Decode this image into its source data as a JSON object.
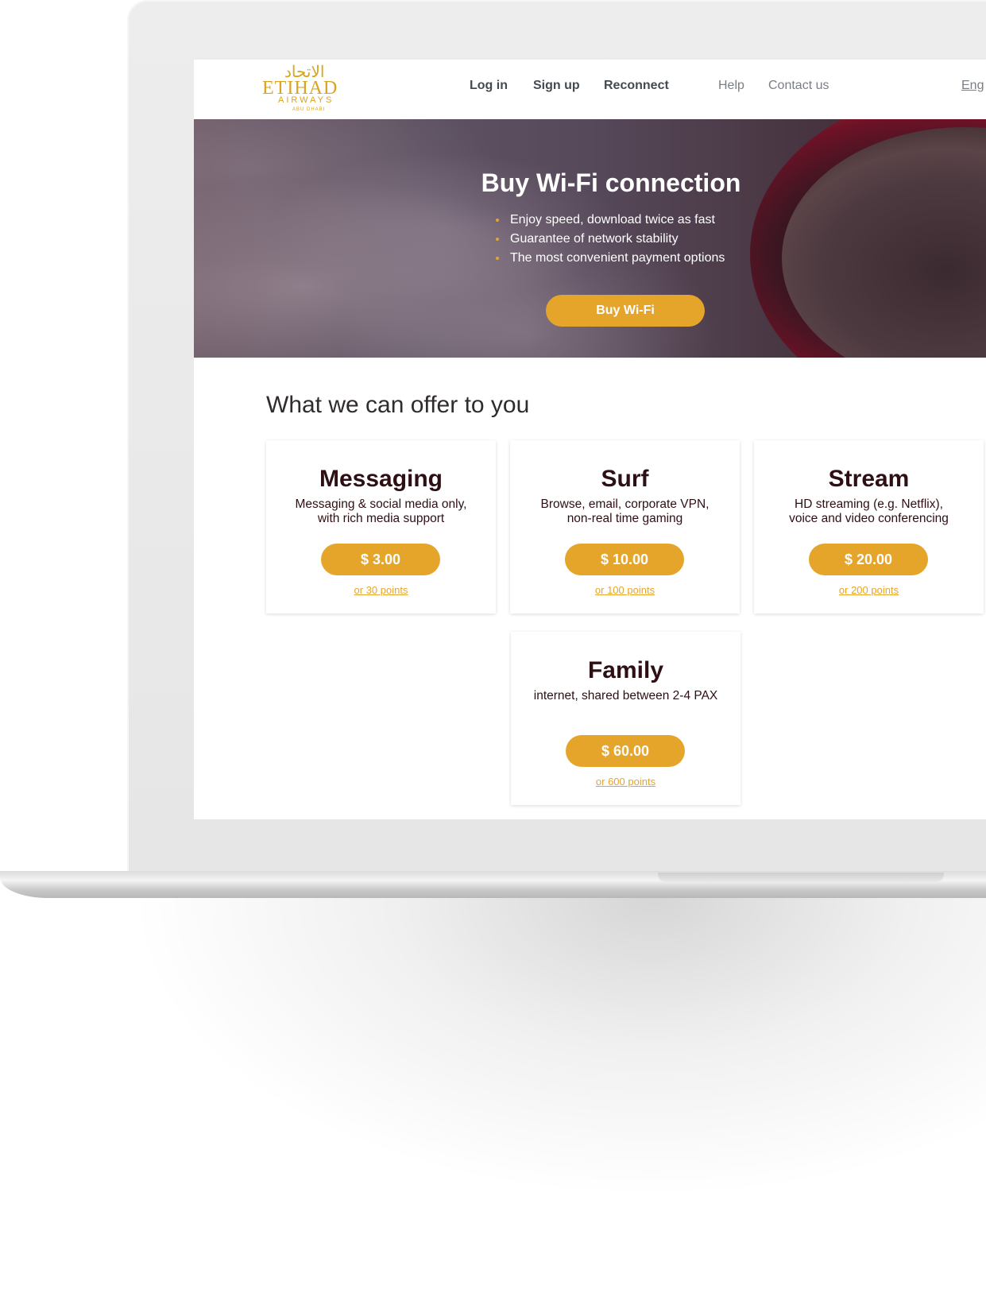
{
  "logo": {
    "arabic": "الاتحاد",
    "name": "ETIHAD",
    "sub": "AIRWAYS",
    "sub2": "ABU DHABI"
  },
  "nav": {
    "login": "Log in",
    "signup": "Sign up",
    "reconnect": "Reconnect",
    "help": "Help",
    "contact": "Contact us",
    "lang": "Eng"
  },
  "hero": {
    "title": "Buy Wi-Fi connection",
    "bullets": [
      "Enjoy speed, download twice as fast",
      "Guarantee of network stability",
      "The most convenient payment options"
    ],
    "button": "Buy Wi-Fi"
  },
  "offers": {
    "title": "What we can offer to you",
    "plans": [
      {
        "name": "Messaging",
        "desc_line1": "Messaging & social media only,",
        "desc_line2": "with rich media support",
        "price": "$ 3.00",
        "points": "or 30 points"
      },
      {
        "name": "Surf",
        "desc_line1": "Browse, email, corporate VPN,",
        "desc_line2": "non-real time gaming",
        "price": "$ 10.00",
        "points": "or 100 points"
      },
      {
        "name": "Stream",
        "desc_line1": "HD streaming (e.g. Netflix),",
        "desc_line2": "voice and video conferencing",
        "price": "$ 20.00",
        "points": "or 200 points"
      },
      {
        "name": "Family",
        "desc_line1": "internet, shared between 2-4 PAX",
        "desc_line2": "",
        "price": "$ 60.00",
        "points": "or 600 points"
      }
    ]
  },
  "colors": {
    "accent": "#e5a52b",
    "title_dark": "#2e0f14",
    "nav_dark": "#444a52"
  }
}
